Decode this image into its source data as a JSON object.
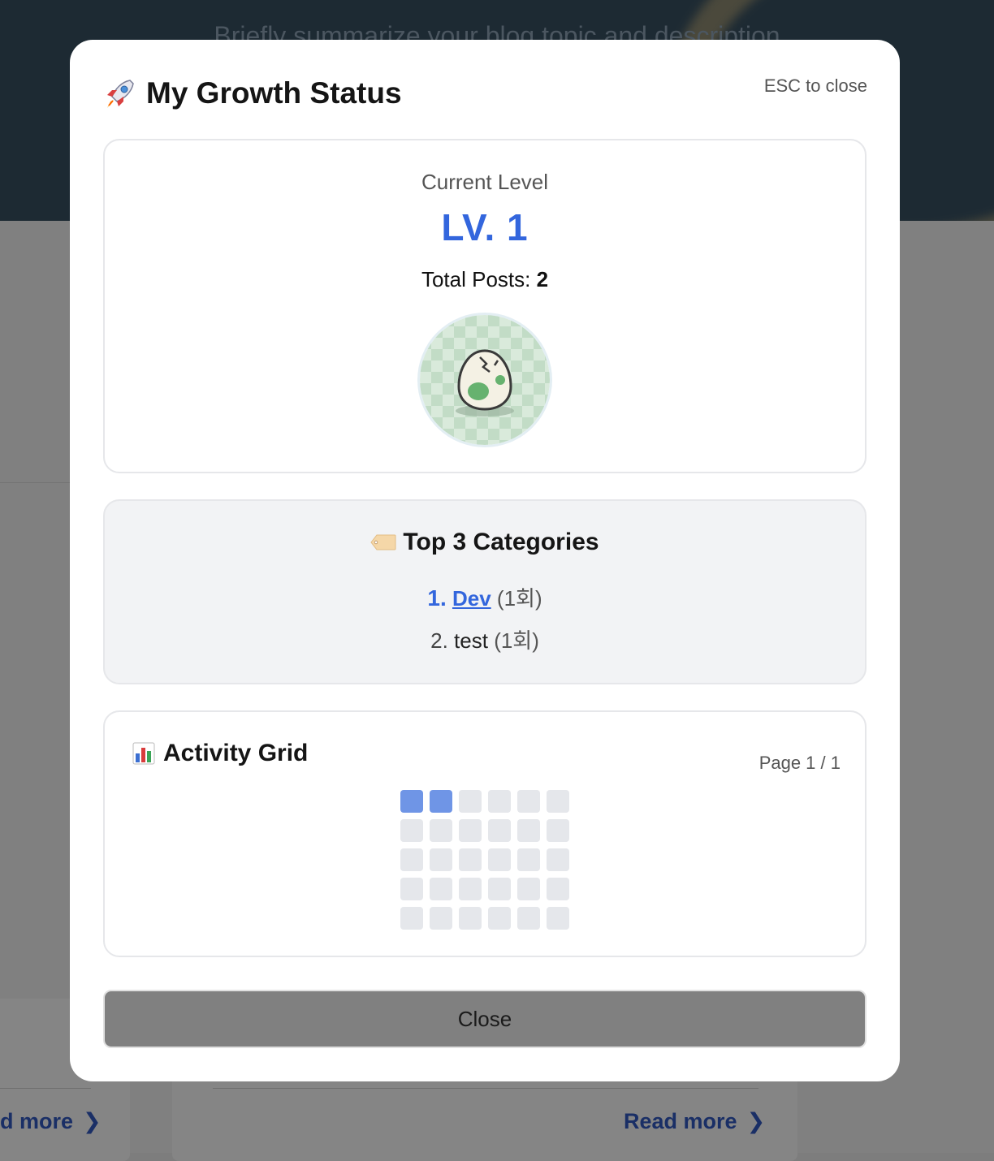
{
  "background": {
    "hero_text": "Briefly summarize your blog topic and description",
    "read_more_left": "d more",
    "read_more_mid": "Read more"
  },
  "modal": {
    "title": "My Growth Status",
    "esc_hint": "ESC to close",
    "level": {
      "caption": "Current Level",
      "value": "LV. 1",
      "total_posts_label": "Total Posts: ",
      "total_posts_value": "2"
    },
    "categories": {
      "title": "Top 3 Categories",
      "items": [
        {
          "rank": "1.",
          "name": "Dev",
          "count": "(1회)"
        },
        {
          "rank": "2.",
          "name": "test",
          "count": "(1회)"
        }
      ]
    },
    "activity": {
      "title": "Activity Grid",
      "page_indicator": "Page 1 / 1",
      "active_cells": 2,
      "total_cells": 30
    },
    "close_label": "Close"
  },
  "colors": {
    "accent": "#3366dd",
    "active_cell": "#6f95e6",
    "inactive_cell": "#e5e7eb"
  },
  "icons": [
    "rocket-icon",
    "tag-icon",
    "bar-chart-icon",
    "chevron-right-icon",
    "egg-avatar"
  ]
}
